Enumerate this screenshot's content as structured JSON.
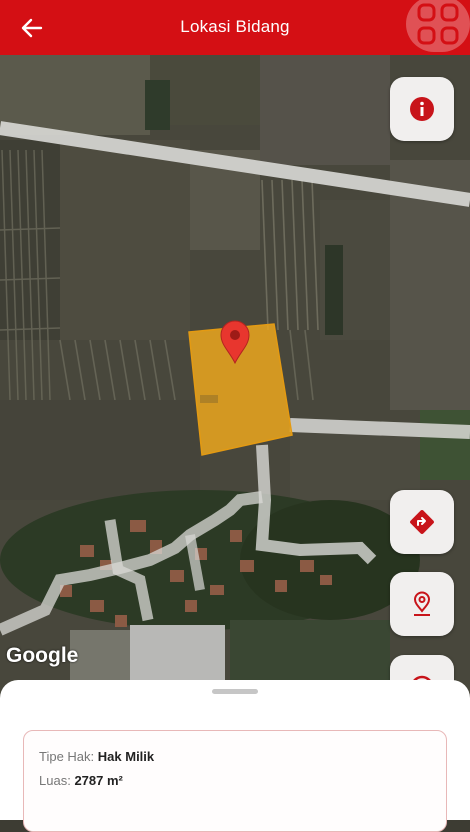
{
  "header": {
    "title": "Lokasi Bidang",
    "back_icon": "arrow-left-icon",
    "menu_icon": "grid-icon"
  },
  "map": {
    "provider_logo": "Google",
    "marker_icon": "map-pin-icon",
    "parcel_color": "#f2a91c"
  },
  "fab_buttons": [
    {
      "name": "info-button",
      "icon": "info-icon"
    },
    {
      "name": "directions-button",
      "icon": "directions-icon"
    },
    {
      "name": "location-button",
      "icon": "location-pin-icon"
    },
    {
      "name": "extra-button",
      "icon": "circle-icon"
    }
  ],
  "details": {
    "tipe_hak_label": "Tipe Hak:",
    "tipe_hak_value": "Hak Milik",
    "luas_label": "Luas:",
    "luas_value": "2787 m²"
  },
  "colors": {
    "primary": "#d40f14",
    "accent_icon": "#c8141a"
  }
}
